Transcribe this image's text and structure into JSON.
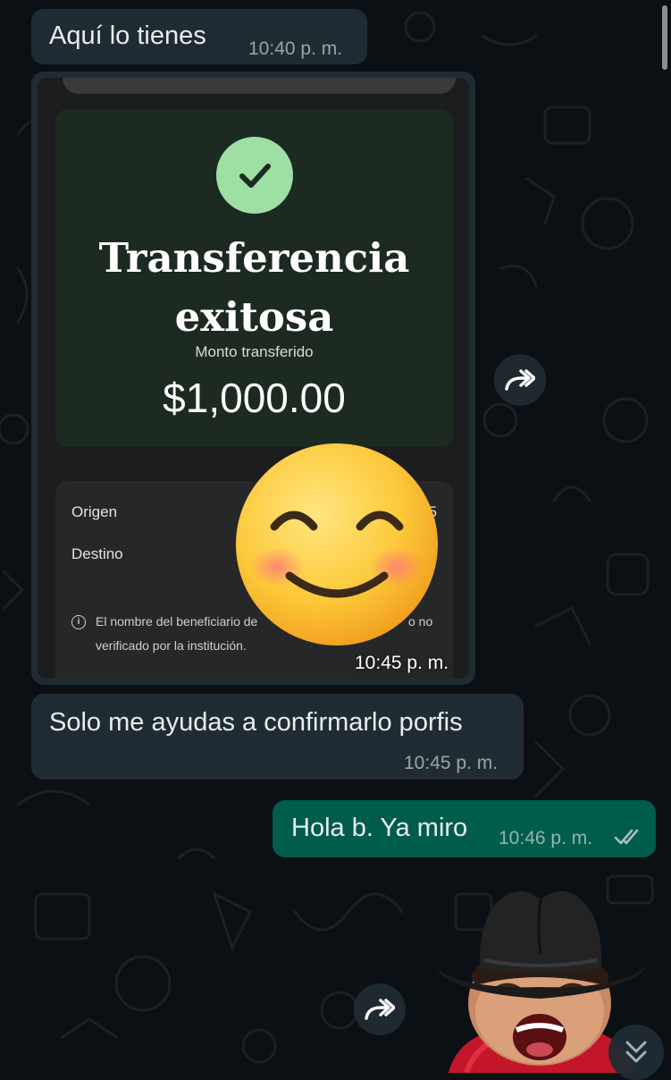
{
  "messages": {
    "m1": {
      "text": "Aquí lo tienes",
      "time": "10:40 p. m."
    },
    "image_msg": {
      "time": "10:45 p. m.",
      "screenshot": {
        "title_line1": "Transferencia",
        "title_line2": "exitosa",
        "amount_label": "Monto transferido",
        "amount": "$1,000.00",
        "origin_label": "Origen",
        "origin_value_partial": "5",
        "destination_label": "Destino",
        "notice_line1_start": "El nombre del beneficiario de",
        "notice_line1_end": "o no",
        "notice_line2": "verificado por la institución."
      }
    },
    "m3": {
      "text": "Solo me ayudas a confirmarlo porfis",
      "time": "10:45 p. m."
    },
    "m4": {
      "text": "Hola b. Ya miro",
      "time": "10:46 p. m.",
      "status": "read"
    }
  },
  "icons": {
    "forward": "forward-icon",
    "scroll": "double-chevron-down-icon",
    "check": "check-icon",
    "info": "info-icon",
    "read_receipt": "double-check-icon"
  },
  "colors": {
    "background": "#0b1014",
    "incoming_bubble": "#202c33",
    "outgoing_bubble": "#005c4b",
    "read_ticks": "#aebac1",
    "success_green": "#9ee0a4"
  }
}
